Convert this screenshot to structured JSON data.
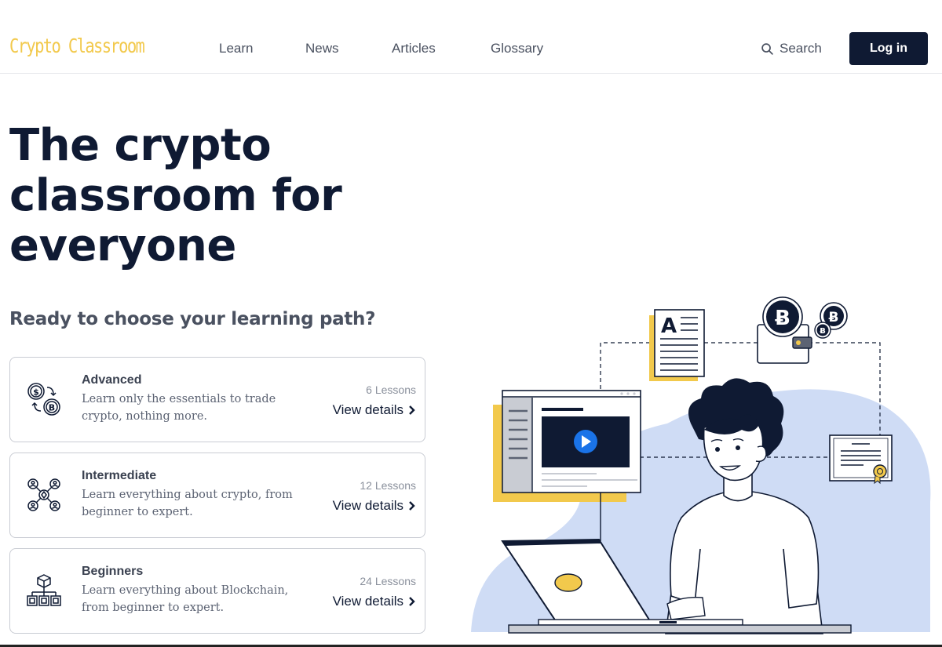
{
  "header": {
    "logo": "Crypto Classroom",
    "nav": [
      "Learn",
      "News",
      "Articles",
      "Glossary"
    ],
    "search_label": "Search",
    "login_label": "Log in"
  },
  "hero": {
    "title_lines": [
      "The crypto",
      "classroom for",
      "everyone"
    ],
    "subtitle": "Ready to choose your learning path?"
  },
  "cards": [
    {
      "title": "Advanced",
      "desc": "Learn only the essentials to trade crypto, nothing more.",
      "lessons": "6 Lessons",
      "cta": "View details",
      "icon": "crypto-exchange-icon"
    },
    {
      "title": "Intermediate",
      "desc": "Learn everything about crypto, from beginner to expert.",
      "lessons": "12 Lessons",
      "cta": "View details",
      "icon": "crypto-network-icon"
    },
    {
      "title": "Beginners",
      "desc": "Learn everything about Blockchain, from beginner to expert.",
      "lessons": "24 Lessons",
      "cta": "View details",
      "icon": "blockchain-icon"
    }
  ],
  "illustration": {
    "document_letter": "A",
    "coin_symbol": "Ƀ"
  },
  "colors": {
    "primary": "#0f1a33",
    "accent_yellow": "#f2c94c",
    "play_blue": "#1a73e8",
    "blob_blue": "#cfdcf5"
  }
}
